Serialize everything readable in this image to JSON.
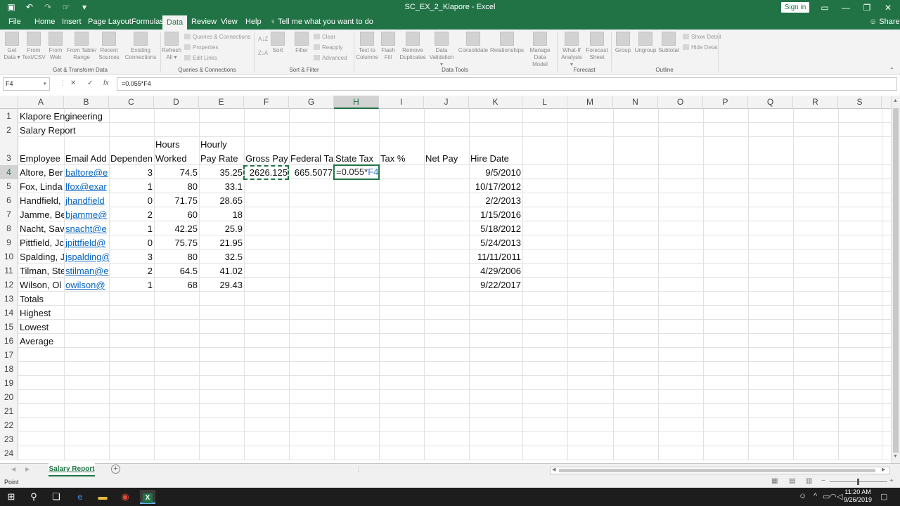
{
  "window": {
    "title": "SC_EX_2_Klapore  -  Excel",
    "sign_in": "Sign in",
    "share": "Share",
    "controls": [
      "▭",
      "—",
      "❐",
      "✕"
    ]
  },
  "ribbon_tabs": [
    "File",
    "Home",
    "Insert",
    "Page Layout",
    "Formulas",
    "Data",
    "Review",
    "View",
    "Help"
  ],
  "active_tab": "Data",
  "tell_me": "Tell me what you want to do",
  "ribbon": {
    "get_data": "Get Data ▾",
    "from_text": "From Text/CSV",
    "from_web": "From Web",
    "from_table": "From Table/ Range",
    "recent_sources": "Recent Sources",
    "existing_connections": "Existing Connections",
    "refresh_all": "Refresh All ▾",
    "queries_connections": "Queries & Connections",
    "properties": "Properties",
    "edit_links": "Edit Links",
    "sort": "Sort",
    "filter": "Filter",
    "clear": "Clear",
    "reapply": "Reapply",
    "advanced": "Advanced",
    "text_to_columns": "Text to Columns",
    "flash_fill": "Flash Fill",
    "remove_duplicates": "Remove Duplicates",
    "data_validation": "Data Validation ▾",
    "consolidate": "Consolidate",
    "relationships": "Relationships",
    "manage_data_model": "Manage Data Model",
    "what_if": "What-If Analysis ▾",
    "forecast_sheet": "Forecast Sheet",
    "group": "Group",
    "ungroup": "Ungroup",
    "subtotal": "Subtotal",
    "show_detail": "Show Detail",
    "hide_detail": "Hide Detail",
    "groups": {
      "get_transform": "Get & Transform Data",
      "queries": "Queries & Connections",
      "sort_filter": "Sort & Filter",
      "data_tools": "Data Tools",
      "forecast": "Forecast",
      "outline": "Outline"
    }
  },
  "formula_bar": {
    "name_box": "F4",
    "formula": "=0.055*F4"
  },
  "columns": [
    "A",
    "B",
    "C",
    "D",
    "E",
    "F",
    "G",
    "H",
    "I",
    "J",
    "K",
    "L",
    "M",
    "N",
    "O",
    "P",
    "Q",
    "R",
    "S"
  ],
  "selected_column": "H",
  "rows": [
    "1",
    "2",
    "3",
    "4",
    "5",
    "6",
    "7",
    "8",
    "9",
    "10",
    "11",
    "12",
    "13",
    "14",
    "15",
    "16",
    "17",
    "18",
    "19",
    "20",
    "21",
    "22",
    "23",
    "24"
  ],
  "selected_row": "4",
  "cells": {
    "a1": "Klapore Engineering",
    "a2": "Salary Report",
    "d2": "Hours",
    "e2": "Hourly",
    "a3": "Employee",
    "b3": "Email Add",
    "c3": "Dependen",
    "d3": "Worked",
    "e3": "Pay Rate",
    "f3": "Gross Pay",
    "g3": "Federal Ta",
    "h3": "State Tax",
    "i3": "Tax %",
    "j3": "Net Pay",
    "k3": "Hire Date",
    "f4": "2626.125",
    "g4": "665.5077",
    "a13": "Totals",
    "a14": "Highest",
    "a15": "Lowest",
    "a16": "Average"
  },
  "editing_cell": {
    "prefix": "=0.055*",
    "ref": "F4"
  },
  "employees": [
    {
      "name": "Altore, Ber",
      "email": "baltore@e",
      "dependents": "3",
      "hours": "74.5",
      "rate": "35.25",
      "hire": "9/5/2010"
    },
    {
      "name": "Fox, Linda",
      "email": "lfox@exar",
      "dependents": "1",
      "hours": "80",
      "rate": "33.1",
      "hire": "10/17/2012"
    },
    {
      "name": "Handfield,",
      "email": "jhandfield",
      "dependents": "0",
      "hours": "71.75",
      "rate": "28.65",
      "hire": "2/2/2013"
    },
    {
      "name": "Jamme, Be",
      "email": "bjamme@",
      "dependents": "2",
      "hours": "60",
      "rate": "18",
      "hire": "1/15/2016"
    },
    {
      "name": "Nacht, Sav",
      "email": "snacht@e",
      "dependents": "1",
      "hours": "42.25",
      "rate": "25.9",
      "hire": "5/18/2012"
    },
    {
      "name": "Pittfield, Jc",
      "email": "jpittfield@",
      "dependents": "0",
      "hours": "75.75",
      "rate": "21.95",
      "hire": "5/24/2013"
    },
    {
      "name": "Spalding, J",
      "email": "jspalding@",
      "dependents": "3",
      "hours": "80",
      "rate": "32.5",
      "hire": "11/11/2011"
    },
    {
      "name": "Tilman, Ste",
      "email": "stilman@e",
      "dependents": "2",
      "hours": "64.5",
      "rate": "41.02",
      "hire": "4/29/2006"
    },
    {
      "name": "Wilson, Ol",
      "email": "owilson@",
      "dependents": "1",
      "hours": "68",
      "rate": "29.43",
      "hire": "9/22/2017"
    }
  ],
  "sheet_tab": "Salary Report",
  "status": "Point",
  "taskbar": {
    "time": "11:20 AM",
    "date": "9/26/2019"
  },
  "colors": {
    "excel_green": "#217346",
    "link_blue": "#0563c1",
    "ref_blue": "#3c77c9"
  }
}
